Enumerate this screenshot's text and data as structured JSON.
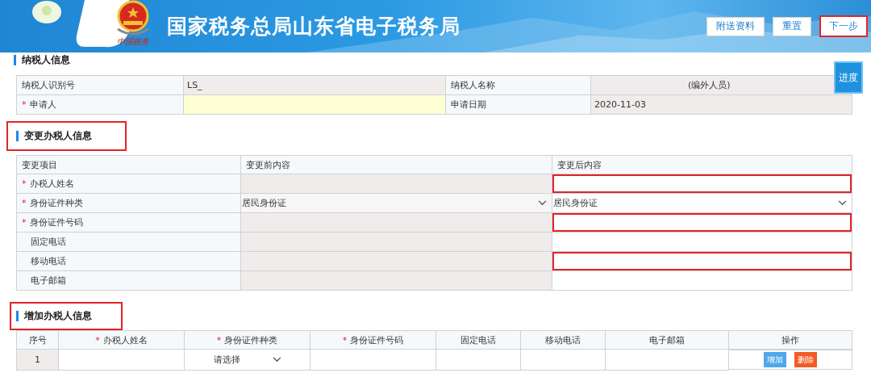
{
  "header": {
    "title": "国家税务总局山东省电子税务局",
    "logo_text": "中国税务",
    "buttons": [
      {
        "label": "附送资料",
        "highlighted": false
      },
      {
        "label": "重置",
        "highlighted": false
      },
      {
        "label": "下一步",
        "highlighted": true
      }
    ]
  },
  "progress_button": "进度",
  "taxpayer_section": {
    "title": "纳税人信息",
    "rows": [
      [
        {
          "label": "纳税人识别号",
          "field": {
            "kind": "readonly",
            "value": "LS_"
          }
        },
        {
          "label": "纳税人名称",
          "field": {
            "kind": "readonly",
            "value": "(编外人员)"
          }
        }
      ],
      [
        {
          "label": "申请人",
          "marker": "*",
          "field": {
            "kind": "input"
          }
        },
        {
          "label": "申请日期",
          "field": {
            "kind": "readonly",
            "value": "2020-11-03"
          }
        }
      ]
    ]
  },
  "change_section": {
    "title": "变更办税人信息",
    "highlighted": true,
    "columns": [
      "变更项目",
      "变更前内容",
      "变更后内容"
    ],
    "rows": [
      {
        "item": "办税人姓名",
        "marker": "*",
        "before": {
          "kind": "readonly"
        },
        "after": {
          "kind": "input",
          "highlighted": true
        }
      },
      {
        "item": "身份证件种类",
        "marker": "*",
        "before": {
          "kind": "select",
          "value": "居民身份证"
        },
        "after": {
          "kind": "select",
          "value": "居民身份证",
          "highlighted": false
        }
      },
      {
        "item": "身份证件号码",
        "marker": "*",
        "before": {
          "kind": "readonly"
        },
        "after": {
          "kind": "input",
          "highlighted": true
        }
      },
      {
        "item": "固定电话",
        "before": {
          "kind": "readonly"
        },
        "after": {
          "kind": "input",
          "highlighted": false
        }
      },
      {
        "item": "移动电话",
        "before": {
          "kind": "readonly"
        },
        "after": {
          "kind": "input",
          "highlighted": true
        }
      },
      {
        "item": "电子邮箱",
        "before": {
          "kind": "readonly"
        },
        "after": {
          "kind": "input",
          "highlighted": false
        }
      }
    ]
  },
  "add_section": {
    "title": "增加办税人信息",
    "highlighted": true,
    "columns": [
      {
        "label": "序号"
      },
      {
        "label": "办税人姓名",
        "marker": "*"
      },
      {
        "label": "身份证件种类",
        "marker": "*"
      },
      {
        "label": "身份证件号码",
        "marker": "*"
      },
      {
        "label": "固定电话"
      },
      {
        "label": "移动电话"
      },
      {
        "label": "电子邮箱"
      },
      {
        "label": "操作"
      }
    ],
    "rows": [
      {
        "cells": [
          {
            "kind": "index",
            "value": "1"
          },
          {
            "kind": "input"
          },
          {
            "kind": "select",
            "placeholder": "请选择"
          },
          {
            "kind": "input"
          },
          {
            "kind": "input"
          },
          {
            "kind": "input"
          },
          {
            "kind": "input"
          },
          {
            "kind": "actions",
            "actions": [
              {
                "label": "增加",
                "kind": "add"
              },
              {
                "label": "删除",
                "kind": "delete"
              }
            ]
          }
        ]
      }
    ]
  }
}
